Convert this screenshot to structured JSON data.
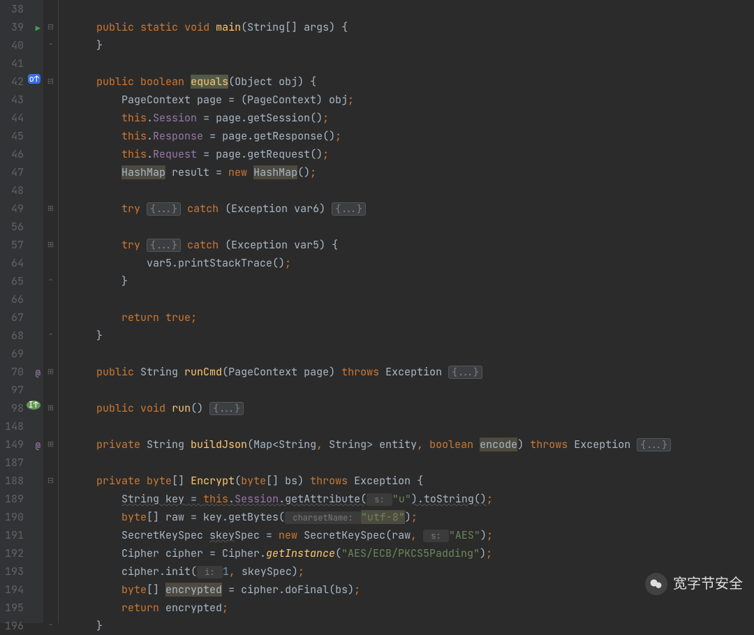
{
  "watermark_text": "宽字节安全",
  "lines": [
    {
      "n": 38,
      "tokens": []
    },
    {
      "n": 39,
      "gicon": "run",
      "fold": "minus",
      "tokens": [
        [
          "    ",
          ""
        ],
        [
          "public",
          "kw"
        ],
        [
          " ",
          ""
        ],
        [
          "static",
          "kw"
        ],
        [
          " ",
          ""
        ],
        [
          "void",
          "kw"
        ],
        [
          " ",
          ""
        ],
        [
          "main",
          "fn"
        ],
        [
          "(",
          ""
        ],
        [
          "String[] args) {",
          ""
        ]
      ]
    },
    {
      "n": 40,
      "fold": "up",
      "tokens": [
        [
          "    }",
          ""
        ]
      ]
    },
    {
      "n": 41,
      "tokens": []
    },
    {
      "n": 42,
      "gicon": "ov",
      "fold": "minus",
      "tokens": [
        [
          "    ",
          ""
        ],
        [
          "public",
          "kw"
        ],
        [
          " ",
          ""
        ],
        [
          "boolean",
          "kw"
        ],
        [
          " ",
          ""
        ],
        [
          "equals",
          "fn hl2"
        ],
        [
          "(",
          ""
        ],
        [
          "Object obj) {",
          ""
        ]
      ]
    },
    {
      "n": 43,
      "tokens": [
        [
          "        PageContext page = (PageContext) obj",
          ""
        ],
        [
          ";",
          "semi"
        ]
      ]
    },
    {
      "n": 44,
      "tokens": [
        [
          "        ",
          ""
        ],
        [
          "this",
          "kw"
        ],
        [
          ".",
          ""
        ],
        [
          "Session",
          "field"
        ],
        [
          " = page.getSession()",
          ""
        ],
        [
          ";",
          "semi"
        ]
      ]
    },
    {
      "n": 45,
      "tokens": [
        [
          "        ",
          ""
        ],
        [
          "this",
          "kw"
        ],
        [
          ".",
          ""
        ],
        [
          "Response",
          "field"
        ],
        [
          " = page.getResponse()",
          ""
        ],
        [
          ";",
          "semi"
        ]
      ]
    },
    {
      "n": 46,
      "tokens": [
        [
          "        ",
          ""
        ],
        [
          "this",
          "kw"
        ],
        [
          ".",
          ""
        ],
        [
          "Request",
          "field"
        ],
        [
          " = page.getRequest()",
          ""
        ],
        [
          ";",
          "semi"
        ]
      ]
    },
    {
      "n": 47,
      "tokens": [
        [
          "        ",
          ""
        ],
        [
          "HashMap",
          "hl"
        ],
        [
          " result = ",
          ""
        ],
        [
          "new",
          "kw"
        ],
        [
          " ",
          ""
        ],
        [
          "HashMap",
          "hl"
        ],
        [
          "()",
          ""
        ],
        [
          ";",
          "semi"
        ]
      ]
    },
    {
      "n": 48,
      "tokens": []
    },
    {
      "n": 49,
      "fold": "plus",
      "tokens": [
        [
          "        ",
          ""
        ],
        [
          "try",
          "kw"
        ],
        [
          " ",
          ""
        ],
        [
          "{...}",
          "fold-brace"
        ],
        [
          " ",
          ""
        ],
        [
          "catch",
          "kw"
        ],
        [
          " (Exception var6) ",
          ""
        ],
        [
          "{...}",
          "fold-brace"
        ]
      ]
    },
    {
      "n": 56,
      "tokens": []
    },
    {
      "n": 57,
      "fold": "plus",
      "tokens": [
        [
          "        ",
          ""
        ],
        [
          "try",
          "kw"
        ],
        [
          " ",
          ""
        ],
        [
          "{...}",
          "fold-brace"
        ],
        [
          " ",
          ""
        ],
        [
          "catch",
          "kw"
        ],
        [
          " (Exception var5) {",
          ""
        ]
      ]
    },
    {
      "n": 64,
      "tokens": [
        [
          "            var5.printStackTrace()",
          ""
        ],
        [
          ";",
          "semi"
        ]
      ]
    },
    {
      "n": 65,
      "fold": "up",
      "tokens": [
        [
          "        }",
          ""
        ]
      ]
    },
    {
      "n": 66,
      "tokens": []
    },
    {
      "n": 67,
      "tokens": [
        [
          "        ",
          ""
        ],
        [
          "return",
          "kw"
        ],
        [
          " ",
          ""
        ],
        [
          "true",
          "kw"
        ],
        [
          ";",
          "semi"
        ]
      ]
    },
    {
      "n": 68,
      "fold": "up",
      "tokens": [
        [
          "    }",
          ""
        ]
      ]
    },
    {
      "n": 69,
      "tokens": []
    },
    {
      "n": 70,
      "gicon": "at",
      "fold": "plus",
      "tokens": [
        [
          "    ",
          ""
        ],
        [
          "public",
          "kw"
        ],
        [
          " String ",
          ""
        ],
        [
          "runCmd",
          "fn"
        ],
        [
          "(PageContext page) ",
          ""
        ],
        [
          "throws",
          "kw"
        ],
        [
          " Exception ",
          ""
        ],
        [
          "{...}",
          "fold-brace"
        ]
      ]
    },
    {
      "n": 97,
      "tokens": []
    },
    {
      "n": 98,
      "gicon": "ov2",
      "fold": "plus",
      "tokens": [
        [
          "    ",
          ""
        ],
        [
          "public",
          "kw"
        ],
        [
          " ",
          ""
        ],
        [
          "void",
          "kw"
        ],
        [
          " ",
          ""
        ],
        [
          "run",
          "fn"
        ],
        [
          "() ",
          ""
        ],
        [
          "{...}",
          "fold-brace"
        ]
      ]
    },
    {
      "n": 148,
      "tokens": []
    },
    {
      "n": 149,
      "gicon": "at",
      "fold": "plus",
      "tokens": [
        [
          "    ",
          ""
        ],
        [
          "private",
          "kw"
        ],
        [
          " String ",
          ""
        ],
        [
          "buildJson",
          "fn"
        ],
        [
          "(Map<String",
          ""
        ],
        [
          ",",
          "semi"
        ],
        [
          " String> entity",
          ""
        ],
        [
          ",",
          "semi"
        ],
        [
          " ",
          ""
        ],
        [
          "boolean",
          "kw"
        ],
        [
          " ",
          ""
        ],
        [
          "encode",
          "hl"
        ],
        [
          ") ",
          ""
        ],
        [
          "throws",
          "kw"
        ],
        [
          " Exception ",
          ""
        ],
        [
          "{...}",
          "fold-brace"
        ]
      ]
    },
    {
      "n": 187,
      "tokens": []
    },
    {
      "n": 188,
      "fold": "minus",
      "tokens": [
        [
          "    ",
          ""
        ],
        [
          "private",
          "kw"
        ],
        [
          " ",
          ""
        ],
        [
          "byte",
          "kw"
        ],
        [
          "[] ",
          ""
        ],
        [
          "Encrypt",
          "fn"
        ],
        [
          "(",
          ""
        ],
        [
          "byte",
          "kw"
        ],
        [
          "[] bs) ",
          ""
        ],
        [
          "throws",
          "kw"
        ],
        [
          " Exception {",
          ""
        ]
      ]
    },
    {
      "n": 189,
      "tokens": [
        [
          "        ",
          ""
        ],
        [
          "String key = ",
          "wavy"
        ],
        [
          "this",
          "kw wavy"
        ],
        [
          ".",
          "wavy"
        ],
        [
          "Session",
          "field wavy"
        ],
        [
          ".getAttribute(",
          "wavy"
        ],
        [
          " s: ",
          "param-hint"
        ],
        [
          "\"u\"",
          "str"
        ],
        [
          ").toString()",
          "wavy"
        ],
        [
          ";",
          "semi"
        ]
      ]
    },
    {
      "n": 190,
      "tokens": [
        [
          "        ",
          ""
        ],
        [
          "byte",
          "kw"
        ],
        [
          "[] raw = key.getBytes(",
          ""
        ],
        [
          " charsetName: ",
          "param-hint"
        ],
        [
          "\"utf-8\"",
          "str hl"
        ],
        [
          ")",
          ""
        ],
        [
          ";",
          "semi"
        ]
      ]
    },
    {
      "n": 191,
      "tokens": [
        [
          "        SecretKeySpec ",
          ""
        ],
        [
          "skey",
          "wavy"
        ],
        [
          "Spec = ",
          ""
        ],
        [
          "new",
          "kw"
        ],
        [
          " SecretKeySpec(raw",
          ""
        ],
        [
          ",",
          "semi"
        ],
        [
          " ",
          ""
        ],
        [
          " s: ",
          "param-hint"
        ],
        [
          "\"AES\"",
          "str"
        ],
        [
          ")",
          ""
        ],
        [
          ";",
          "semi"
        ]
      ]
    },
    {
      "n": 192,
      "tokens": [
        [
          "        Cipher cipher = Cipher.",
          ""
        ],
        [
          "getInstance",
          "fni"
        ],
        [
          "(",
          ""
        ],
        [
          "\"AES/ECB/PKCS5Padding\"",
          "str"
        ],
        [
          ")",
          ""
        ],
        [
          ";",
          "semi"
        ]
      ]
    },
    {
      "n": 193,
      "tokens": [
        [
          "        cipher.init(",
          ""
        ],
        [
          " i: ",
          "param-hint"
        ],
        [
          "1",
          "num"
        ],
        [
          ",",
          "semi"
        ],
        [
          " skeySpec)",
          ""
        ],
        [
          ";",
          "semi"
        ]
      ]
    },
    {
      "n": 194,
      "tokens": [
        [
          "        ",
          ""
        ],
        [
          "byte",
          "kw"
        ],
        [
          "[] ",
          ""
        ],
        [
          "encrypted",
          "hl"
        ],
        [
          " = cipher.doFinal(bs)",
          ""
        ],
        [
          ";",
          "semi"
        ]
      ]
    },
    {
      "n": 195,
      "tokens": [
        [
          "        ",
          ""
        ],
        [
          "return",
          "kw"
        ],
        [
          " encrypted",
          ""
        ],
        [
          ";",
          "semi"
        ]
      ]
    },
    {
      "n": 196,
      "fold": "up",
      "tokens": [
        [
          "    }",
          ""
        ]
      ]
    }
  ]
}
